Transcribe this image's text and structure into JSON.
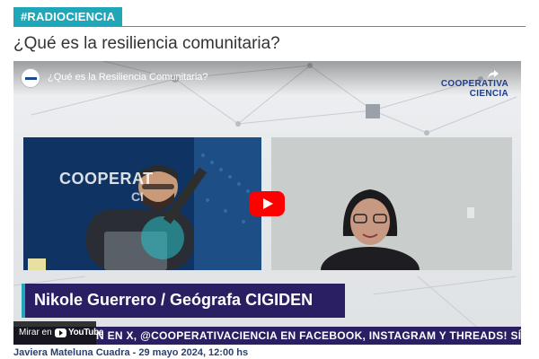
{
  "tag": "#RADIOCIENCIA",
  "article": {
    "title": "¿Qué es la resiliencia comunitaria?"
  },
  "video": {
    "yt_title": "¿Qué es la Resiliencia Comunitaria?",
    "share_label": "",
    "brand_line1": "COOPERATIVA",
    "brand_line2": "CIENCIA",
    "studio_line1": "COOPERAT",
    "studio_line2": "CI",
    "guest_banner": "Nikole Guerrero / Geógrafa CIGIDEN",
    "ticker": "N EN X, @COOPERATIVACIENCIA EN FACEBOOK, INSTAGRAM Y THREADS! SÍGUENOS EN NUESTI",
    "watch_on": "Mirar en",
    "youtube": "YouTube",
    "icons": [
      "channel-avatar-icon",
      "share-icon",
      "play-icon",
      "youtube-icon"
    ],
    "accent": "#1fa6b8",
    "banner_color": "#2b1f63"
  },
  "byline": "Javiera Mateluna Cuadra  - 29 mayo 2024, 12:00 hs"
}
